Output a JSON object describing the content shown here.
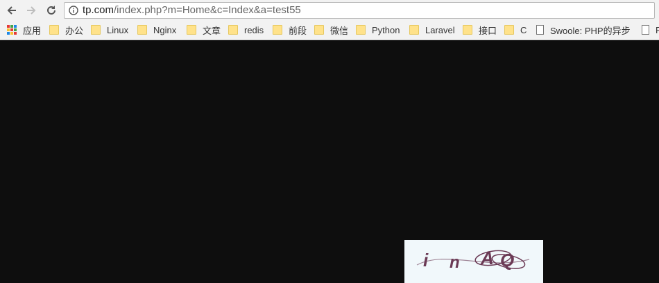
{
  "toolbar": {
    "back_icon": "arrow-left-icon",
    "forward_icon": "arrow-right-icon",
    "reload_icon": "reload-icon"
  },
  "address_bar": {
    "url_host": "tp.com",
    "url_rest": "/index.php?m=Home&c=Index&a=test55"
  },
  "bookmarks": [
    {
      "label": "应用",
      "icon": "apps-grid-icon"
    },
    {
      "label": "办公",
      "icon": "folder-icon"
    },
    {
      "label": "Linux",
      "icon": "folder-icon"
    },
    {
      "label": "Nginx",
      "icon": "folder-icon"
    },
    {
      "label": "文章",
      "icon": "folder-icon"
    },
    {
      "label": "redis",
      "icon": "folder-icon"
    },
    {
      "label": "前段",
      "icon": "folder-icon"
    },
    {
      "label": "微信",
      "icon": "folder-icon"
    },
    {
      "label": "Python",
      "icon": "folder-icon"
    },
    {
      "label": "Laravel",
      "icon": "folder-icon"
    },
    {
      "label": "接口",
      "icon": "folder-icon"
    },
    {
      "label": "C",
      "icon": "folder-icon"
    },
    {
      "label": "Swoole: PHP的异步",
      "icon": "page-icon"
    },
    {
      "label": "R",
      "icon": "page-icon"
    }
  ],
  "captcha": {
    "chars": [
      "i",
      "n",
      "A",
      "Q"
    ],
    "text_color": "#6b3a55",
    "background": "#f1f8fb"
  },
  "page": {
    "background": "#0e0e0e"
  }
}
